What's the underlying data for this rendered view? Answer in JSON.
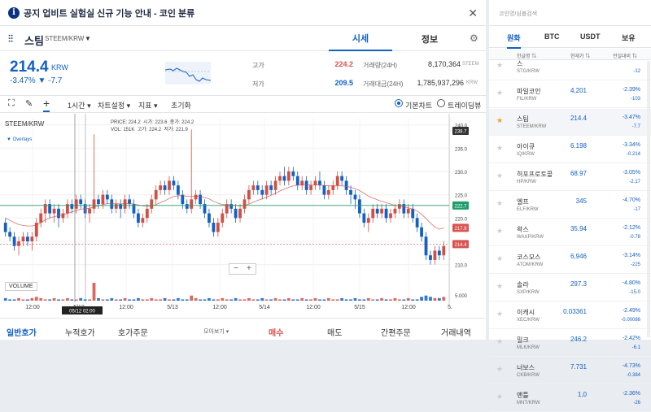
{
  "notice": {
    "text": "공지 업비트 실험실 신규 기능 안내 - 코인 분류",
    "close": "✕"
  },
  "coin": {
    "name": "스팀",
    "pair": "STEEM/KRW",
    "dropdown": "▼"
  },
  "tabs": {
    "sise": "시세",
    "info": "정보"
  },
  "price": {
    "value": "214.4",
    "unit": "KRW",
    "change": "-3.47% ▼ -7.7"
  },
  "stats": {
    "high_label": "고가",
    "high": "224.2",
    "low_label": "저가",
    "low": "209.5",
    "vol_label": "거래량(24H)",
    "vol": "8,170,364",
    "vol_unit": "STEEM",
    "amt_label": "거래대금(24H)",
    "amt": "1,785,937,296",
    "amt_unit": "KRW"
  },
  "toolbar": {
    "interval": "1시간 ▾",
    "chart_settings": "차트설정 ▾",
    "indicators": "지표 ▾",
    "reset": "초기화",
    "basic_chart": "기본차트",
    "trading_view": "트레이딩뷰"
  },
  "chart_panel": {
    "symbol": "STEEM/KRW",
    "ohlc": {
      "price_label": "PRICE:",
      "price": "224.2",
      "open_label": "시가:",
      "open": "223.6",
      "high_label": "종가:",
      "high": "224.2",
      "vol_label": "VOL:",
      "vol": "151K",
      "high2_label": "고가:",
      "high2": "224.2",
      "low_label": "저가:",
      "low": "221.9"
    },
    "overlays": "Overlays",
    "volume_label": "VOLUME",
    "crosshair_date": "05/12 02:00",
    "zoom_minus": "−",
    "zoom_plus": "+"
  },
  "chart_data": {
    "type": "candlestick",
    "y_ticks": [
      "240.0",
      "235.0",
      "230.0",
      "225.0",
      "220.0",
      "215.0",
      "210.0",
      "5.000"
    ],
    "y_range": [
      207.5,
      241.5
    ],
    "price_tags": [
      {
        "label": "238.7",
        "value": 238.7,
        "color": "#333333"
      },
      {
        "label": "222.7",
        "value": 222.7,
        "color": "#1e9e6a"
      },
      {
        "label": "217.9",
        "value": 217.9,
        "color": "#d9534f"
      },
      {
        "label": "214.4",
        "value": 214.4,
        "color": "#d9534f"
      }
    ],
    "x_labels": [
      "12:00",
      "5/12",
      "12:00",
      "5/13",
      "12:00",
      "5/14",
      "12:00",
      "5/15",
      "12:00",
      "5."
    ],
    "candles": [
      [
        219,
        217,
        220,
        216
      ],
      [
        217,
        216,
        218,
        215
      ],
      [
        216,
        214,
        217,
        213
      ],
      [
        214,
        215,
        216,
        212
      ],
      [
        215,
        216,
        217,
        214
      ],
      [
        216,
        215,
        217,
        214
      ],
      [
        215,
        216,
        217,
        213
      ],
      [
        216,
        219,
        220,
        215
      ],
      [
        219,
        221,
        222,
        218
      ],
      [
        221,
        223,
        224,
        219
      ],
      [
        223,
        221,
        224,
        220
      ],
      [
        221,
        222,
        223,
        219
      ],
      [
        222,
        220,
        223,
        218
      ],
      [
        220,
        221,
        222,
        219
      ],
      [
        221,
        223,
        224,
        220
      ],
      [
        223,
        222,
        224,
        221
      ],
      [
        222,
        224,
        225,
        221
      ],
      [
        224,
        223,
        225,
        222
      ],
      [
        223,
        221,
        224,
        220
      ],
      [
        221,
        222,
        223,
        219
      ],
      [
        222,
        224,
        238,
        221
      ],
      [
        224,
        223,
        225,
        222
      ],
      [
        223,
        225,
        226,
        222
      ],
      [
        225,
        224,
        226,
        223
      ],
      [
        224,
        222,
        225,
        221
      ],
      [
        222,
        223,
        224,
        221
      ],
      [
        223,
        222,
        224,
        220
      ],
      [
        222,
        224,
        225,
        221
      ],
      [
        224,
        223,
        225,
        222
      ],
      [
        223,
        221,
        224,
        220
      ],
      [
        221,
        219,
        222,
        218
      ],
      [
        219,
        220,
        221,
        218
      ],
      [
        220,
        222,
        223,
        219
      ],
      [
        222,
        224,
        225,
        221
      ],
      [
        224,
        226,
        227,
        223
      ],
      [
        226,
        227,
        228,
        225
      ],
      [
        227,
        226,
        228,
        225
      ],
      [
        226,
        228,
        229,
        225
      ],
      [
        228,
        227,
        229,
        226
      ],
      [
        227,
        225,
        228,
        224
      ],
      [
        225,
        223,
        226,
        222
      ],
      [
        223,
        222,
        224,
        221
      ],
      [
        222,
        224,
        239,
        221
      ],
      [
        224,
        225,
        226,
        223
      ],
      [
        225,
        223,
        226,
        222
      ],
      [
        223,
        221,
        224,
        220
      ],
      [
        221,
        219,
        222,
        218
      ],
      [
        219,
        217,
        220,
        216
      ],
      [
        217,
        219,
        220,
        216
      ],
      [
        219,
        221,
        222,
        218
      ],
      [
        221,
        223,
        224,
        220
      ],
      [
        223,
        222,
        224,
        221
      ],
      [
        222,
        220,
        223,
        219
      ],
      [
        220,
        222,
        223,
        219
      ],
      [
        222,
        224,
        225,
        221
      ],
      [
        224,
        226,
        227,
        223
      ],
      [
        226,
        227,
        228,
        225
      ],
      [
        227,
        226,
        228,
        225
      ],
      [
        226,
        225,
        227,
        224
      ],
      [
        225,
        227,
        228,
        224
      ],
      [
        227,
        226,
        228,
        225
      ],
      [
        226,
        228,
        229,
        225
      ],
      [
        228,
        229,
        230,
        227
      ],
      [
        229,
        228,
        231,
        227
      ],
      [
        228,
        230,
        231,
        227
      ],
      [
        230,
        229,
        231,
        228
      ],
      [
        229,
        227,
        230,
        226
      ],
      [
        227,
        228,
        229,
        226
      ],
      [
        228,
        226,
        229,
        225
      ],
      [
        226,
        227,
        228,
        225
      ],
      [
        227,
        228,
        229,
        226
      ],
      [
        228,
        227,
        230,
        226
      ],
      [
        227,
        225,
        228,
        224
      ],
      [
        225,
        226,
        227,
        224
      ],
      [
        226,
        227,
        228,
        225
      ],
      [
        227,
        229,
        230,
        226
      ],
      [
        229,
        228,
        230,
        227
      ],
      [
        228,
        226,
        229,
        225
      ],
      [
        226,
        225,
        227,
        223
      ],
      [
        225,
        224,
        226,
        222
      ],
      [
        224,
        221,
        225,
        220
      ],
      [
        221,
        219,
        222,
        218
      ],
      [
        219,
        220,
        221,
        217
      ],
      [
        220,
        222,
        223,
        219
      ],
      [
        222,
        221,
        223,
        220
      ],
      [
        221,
        222,
        223,
        220
      ],
      [
        222,
        220,
        223,
        219
      ],
      [
        220,
        221,
        222,
        219
      ],
      [
        221,
        222,
        223,
        220
      ],
      [
        222,
        223,
        224,
        221
      ],
      [
        223,
        221,
        224,
        220
      ],
      [
        221,
        222,
        223,
        220
      ],
      [
        222,
        220,
        223,
        219
      ],
      [
        220,
        218,
        221,
        217
      ],
      [
        218,
        216,
        219,
        215
      ],
      [
        216,
        212,
        217,
        211
      ],
      [
        212,
        211,
        213,
        210
      ],
      [
        211,
        213,
        214,
        210
      ],
      [
        213,
        212,
        214,
        211
      ],
      [
        212,
        214,
        215,
        211
      ]
    ],
    "ma": [
      220,
      219.5,
      219,
      218.6,
      218.4,
      218.3,
      218.3,
      218.5,
      219,
      219.6,
      220,
      220.3,
      220.5,
      220.7,
      221,
      221.3,
      221.6,
      221.9,
      222,
      222.1,
      222.4,
      222.6,
      222.9,
      223.1,
      223.1,
      223.1,
      223,
      223.1,
      223.1,
      223,
      222.8,
      222.6,
      222.5,
      222.6,
      222.9,
      223.3,
      223.7,
      224.2,
      224.6,
      224.8,
      224.8,
      224.7,
      224.7,
      224.7,
      224.6,
      224.4,
      224.1,
      223.6,
      223.2,
      222.9,
      222.8,
      222.8,
      222.7,
      222.6,
      222.7,
      223,
      223.4,
      223.8,
      224.1,
      224.5,
      224.9,
      225.3,
      225.8,
      226.2,
      226.6,
      226.9,
      227.1,
      227.2,
      227.2,
      227.1,
      227.1,
      227.1,
      227,
      226.9,
      226.9,
      226.9,
      226.9,
      226.8,
      226.6,
      226.3,
      225.9,
      225.3,
      224.7,
      224.3,
      223.9,
      223.6,
      223.3,
      223,
      222.7,
      222.6,
      222.4,
      222.2,
      221.9,
      221.5,
      220.8,
      219.9,
      218.9,
      218.1,
      217.6,
      217.9
    ],
    "volumes": [
      2,
      1,
      1,
      2,
      1,
      1,
      2,
      3,
      2,
      1,
      1,
      2,
      1,
      1,
      2,
      1,
      1,
      2,
      1,
      1,
      14,
      2,
      1,
      1,
      2,
      1,
      1,
      2,
      1,
      1,
      2,
      1,
      1,
      2,
      1,
      1,
      2,
      1,
      1,
      2,
      1,
      1,
      4,
      2,
      1,
      1,
      2,
      1,
      1,
      2,
      1,
      1,
      2,
      1,
      1,
      2,
      1,
      1,
      2,
      1,
      1,
      2,
      1,
      1,
      2,
      1,
      1,
      2,
      1,
      1,
      2,
      1,
      1,
      2,
      1,
      1,
      2,
      1,
      1,
      2,
      1,
      1,
      2,
      1,
      1,
      2,
      1,
      1,
      2,
      1,
      1,
      2,
      1,
      1,
      3,
      4,
      3,
      2,
      2,
      3
    ]
  },
  "bottom_tabs": {
    "order": "일반호가",
    "cumulative": "누적호가",
    "main": "호가주문",
    "more": "모아보기 ▾",
    "buy": "매수",
    "sell": "매도",
    "simple": "간편주문",
    "history": "거래내역"
  },
  "sidebar": {
    "search_placeholder": "코인명/심볼검색",
    "markets": [
      "원화",
      "BTC",
      "USDT",
      "보유"
    ],
    "col_name": "한글명 ⇅",
    "col_price": "현재가 ⇅",
    "col_change": "전일대비 ⇅",
    "coins": [
      {
        "name": "스",
        "pair": "STG/KRW",
        "price": "",
        "pct": "",
        "diff": "-12"
      },
      {
        "name": "파일코인",
        "pair": "FIL/KRW",
        "price": "4,201",
        "pct": "-2.39%",
        "diff": "-103"
      },
      {
        "name": "스팀",
        "pair": "STEEM/KRW",
        "price": "214.4",
        "pct": "-3.47%",
        "diff": "-7.7"
      },
      {
        "name": "아이큐",
        "pair": "IQ/KRW",
        "price": "6.198",
        "pct": "-3.34%",
        "diff": "-0.214"
      },
      {
        "name": "히포프로토콜",
        "pair": "HP/KRW",
        "price": "68.97",
        "pct": "-3.05%",
        "diff": "-2.17"
      },
      {
        "name": "엘프",
        "pair": "ELF/KRW",
        "price": "345",
        "pct": "-4.70%",
        "diff": "-17"
      },
      {
        "name": "왁스",
        "pair": "WAXP/KRW",
        "price": "35.94",
        "pct": "-2.12%",
        "diff": "-0.78"
      },
      {
        "name": "코스모스",
        "pair": "ATOM/KRW",
        "price": "6,946",
        "pct": "-3.14%",
        "diff": "-225"
      },
      {
        "name": "솔라",
        "pair": "SXP/KRW",
        "price": "297.3",
        "pct": "-4.80%",
        "diff": "-15.0"
      },
      {
        "name": "이캐시",
        "pair": "XEC/KRW",
        "price": "0.03361",
        "pct": "-2.49%",
        "diff": "-0.00086"
      },
      {
        "name": "밀크",
        "pair": "MLK/KRW",
        "price": "246.2",
        "pct": "-2.42%",
        "diff": "-6.1"
      },
      {
        "name": "너보스",
        "pair": "CKB/KRW",
        "price": "7.731",
        "pct": "-4.73%",
        "diff": "-0.384"
      },
      {
        "name": "맨틀",
        "pair": "MNT/KRW",
        "price": "1,0",
        "pct": "-2.36%",
        "diff": "-26"
      }
    ]
  }
}
